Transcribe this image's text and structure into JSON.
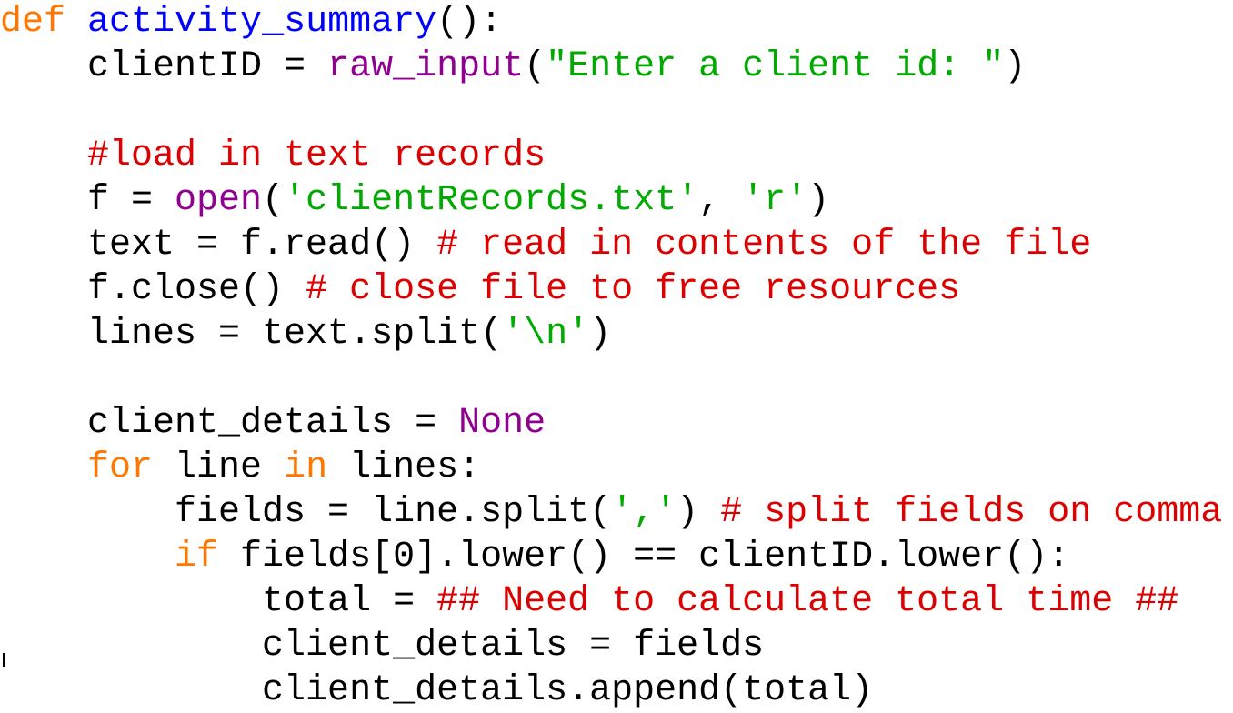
{
  "code": {
    "language": "python",
    "lines": [
      [
        {
          "t": "kw",
          "v": "def"
        },
        {
          "t": "pl",
          "v": " "
        },
        {
          "t": "fn",
          "v": "activity_summary"
        },
        {
          "t": "pl",
          "v": "():"
        }
      ],
      [
        {
          "t": "pl",
          "v": "    clientID = "
        },
        {
          "t": "bi",
          "v": "raw_input"
        },
        {
          "t": "pl",
          "v": "("
        },
        {
          "t": "str",
          "v": "\"Enter a client id: \""
        },
        {
          "t": "pl",
          "v": ")"
        }
      ],
      [],
      [
        {
          "t": "pl",
          "v": "    "
        },
        {
          "t": "cm",
          "v": "#load in text records"
        }
      ],
      [
        {
          "t": "pl",
          "v": "    f = "
        },
        {
          "t": "bi",
          "v": "open"
        },
        {
          "t": "pl",
          "v": "("
        },
        {
          "t": "str",
          "v": "'clientRecords.txt'"
        },
        {
          "t": "pl",
          "v": ", "
        },
        {
          "t": "str",
          "v": "'r'"
        },
        {
          "t": "pl",
          "v": ")"
        }
      ],
      [
        {
          "t": "pl",
          "v": "    text = f.read() "
        },
        {
          "t": "cm",
          "v": "# read in contents of the file"
        }
      ],
      [
        {
          "t": "pl",
          "v": "    f.close() "
        },
        {
          "t": "cm",
          "v": "# close file to free resources"
        }
      ],
      [
        {
          "t": "pl",
          "v": "    lines = text.split("
        },
        {
          "t": "str",
          "v": "'\\n'"
        },
        {
          "t": "pl",
          "v": ")"
        }
      ],
      [],
      [
        {
          "t": "pl",
          "v": "    client_details = "
        },
        {
          "t": "bi",
          "v": "None"
        }
      ],
      [
        {
          "t": "pl",
          "v": "    "
        },
        {
          "t": "kw",
          "v": "for"
        },
        {
          "t": "pl",
          "v": " line "
        },
        {
          "t": "kw",
          "v": "in"
        },
        {
          "t": "pl",
          "v": " lines:"
        }
      ],
      [
        {
          "t": "pl",
          "v": "        fields = line.split("
        },
        {
          "t": "str",
          "v": "','"
        },
        {
          "t": "pl",
          "v": ") "
        },
        {
          "t": "cm",
          "v": "# split fields on comma"
        }
      ],
      [
        {
          "t": "pl",
          "v": "        "
        },
        {
          "t": "kw",
          "v": "if"
        },
        {
          "t": "pl",
          "v": " fields[0].lower() == clientID.lower():"
        }
      ],
      [
        {
          "t": "pl",
          "v": "            total = "
        },
        {
          "t": "cm",
          "v": "## Need to calculate total time ##"
        }
      ],
      [
        {
          "t": "pl",
          "v": "            client_details = fields"
        }
      ],
      [
        {
          "t": "pl",
          "v": "            client_details.append(total)"
        }
      ]
    ]
  },
  "colors": {
    "keyword": "#ff7700",
    "function_name": "#0000ff",
    "builtin": "#900090",
    "string": "#00aa00",
    "comment": "#dd0000",
    "plain": "#000000",
    "background": "#ffffff"
  }
}
